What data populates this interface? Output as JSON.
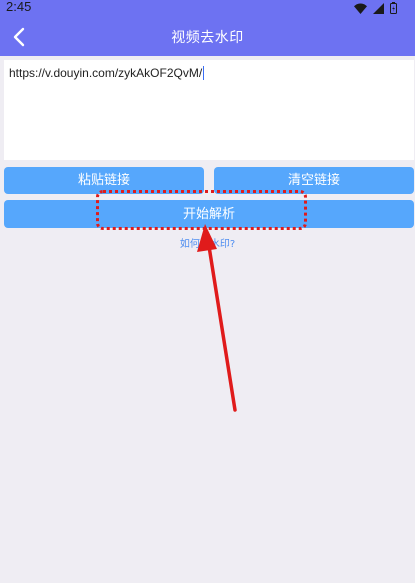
{
  "status_bar": {
    "time": "2:45",
    "icons": [
      "wifi-icon",
      "signal-icon",
      "battery-icon"
    ]
  },
  "app_bar": {
    "title": "视频去水印",
    "back_icon": "chevron-left-icon",
    "color": "#6d72f2"
  },
  "url_input": {
    "value": "https://v.douyin.com/zykAkOF2QvM/"
  },
  "buttons": {
    "paste": "粘贴链接",
    "clear": "清空链接",
    "parse": "开始解析",
    "color": "#56a7fc"
  },
  "help_link": "如何去水印?",
  "annotation": {
    "color": "#e01b1b",
    "target": "开始解析"
  }
}
